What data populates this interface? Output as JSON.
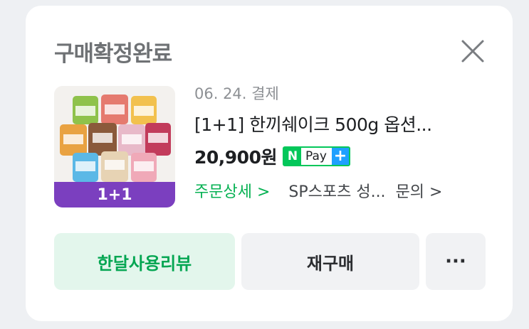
{
  "card": {
    "status_label": "구매확정완료"
  },
  "order": {
    "date": "06. 24. 결제",
    "product_title": "[1+1] 한끼쉐이크 500g 옵션...",
    "price": "20,900원",
    "thumbnail_badge": "1+1",
    "thumbnail_badge_color": "#7b3fbf"
  },
  "npay": {
    "logo_letter": "N",
    "label": "Pay",
    "plus": "+"
  },
  "links": {
    "detail": "주문상세 >",
    "store": "SP스포츠 성...",
    "inquiry": "문의 >"
  },
  "buttons": {
    "review": "한달사용리뷰",
    "rebuy": "재구매",
    "more": "···"
  },
  "colors": {
    "accent_green": "#03c75a",
    "npay_plus_blue": "#1ea0ff"
  }
}
